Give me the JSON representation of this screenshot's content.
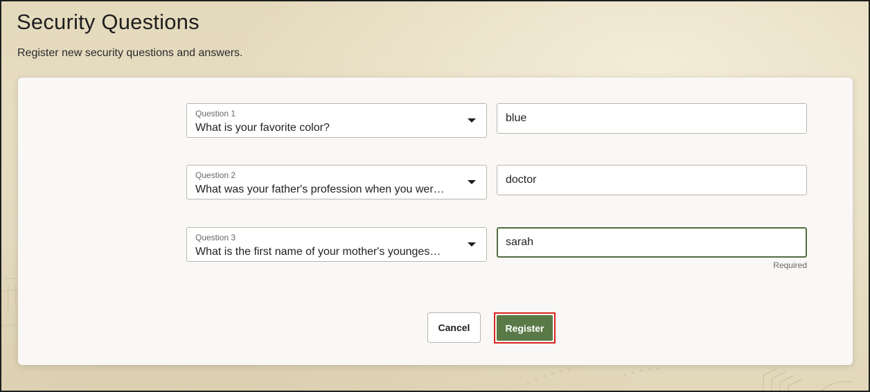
{
  "page": {
    "title": "Security Questions",
    "subtitle": "Register new security questions and answers."
  },
  "form": {
    "questions": [
      {
        "label": "Question 1",
        "value": "What is your favorite color?",
        "answer": "blue"
      },
      {
        "label": "Question 2",
        "value": "What was your father's profession when you wer…",
        "answer": "doctor"
      },
      {
        "label": "Question 3",
        "value": "What is the first name of your mother's younges…",
        "answer": "sarah"
      }
    ],
    "answer3_helper": "Required"
  },
  "actions": {
    "cancel_label": "Cancel",
    "register_label": "Register"
  },
  "colors": {
    "primary_button": "#597a47",
    "highlight_outline": "#d9211c",
    "focus_border": "#4f6b3d"
  },
  "icons": {
    "dropdown": "chevron-down-icon"
  }
}
